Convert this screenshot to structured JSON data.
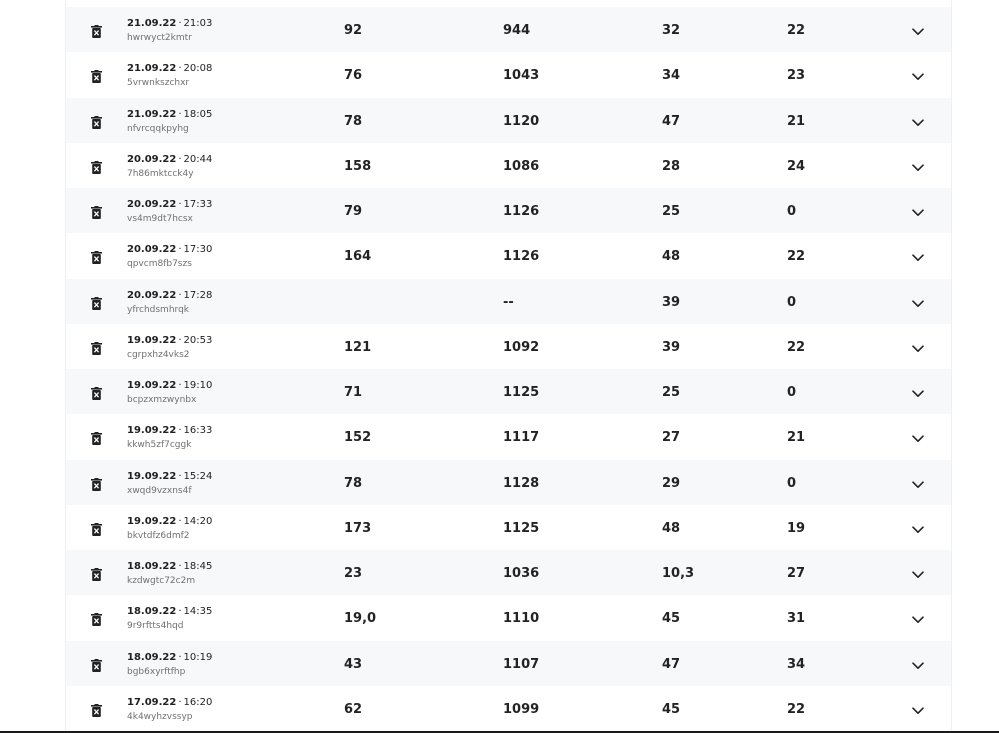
{
  "icons": {
    "delete": "trash-icon",
    "expand": "chevron-down-icon"
  },
  "colors": {
    "row_alt": "#f7f8fa",
    "text_primary": "#232323",
    "text_secondary": "#707070"
  },
  "rows": [
    {
      "date": "21.09.22",
      "time": "21:03",
      "code": "hwrwyct2kmtr",
      "v1": "92",
      "v2": "944",
      "v3": "32",
      "v4": "22"
    },
    {
      "date": "21.09.22",
      "time": "20:08",
      "code": "5vrwnkszchxr",
      "v1": "76",
      "v2": "1043",
      "v3": "34",
      "v4": "23"
    },
    {
      "date": "21.09.22",
      "time": "18:05",
      "code": "nfvrcqqkpyhg",
      "v1": "78",
      "v2": "1120",
      "v3": "47",
      "v4": "21"
    },
    {
      "date": "20.09.22",
      "time": "20:44",
      "code": "7h86mktcck4y",
      "v1": "158",
      "v2": "1086",
      "v3": "28",
      "v4": "24"
    },
    {
      "date": "20.09.22",
      "time": "17:33",
      "code": "vs4m9dt7hcsx",
      "v1": "79",
      "v2": "1126",
      "v3": "25",
      "v4": "0"
    },
    {
      "date": "20.09.22",
      "time": "17:30",
      "code": "qpvcm8fb7szs",
      "v1": "164",
      "v2": "1126",
      "v3": "48",
      "v4": "22"
    },
    {
      "date": "20.09.22",
      "time": "17:28",
      "code": "yfrchdsmhrqk",
      "v1": "",
      "v2": "--",
      "v3": "39",
      "v4": "0"
    },
    {
      "date": "19.09.22",
      "time": "20:53",
      "code": "cgrpxhz4vks2",
      "v1": "121",
      "v2": "1092",
      "v3": "39",
      "v4": "22"
    },
    {
      "date": "19.09.22",
      "time": "19:10",
      "code": "bcpzxmzwynbx",
      "v1": "71",
      "v2": "1125",
      "v3": "25",
      "v4": "0"
    },
    {
      "date": "19.09.22",
      "time": "16:33",
      "code": "kkwh5zf7cggk",
      "v1": "152",
      "v2": "1117",
      "v3": "27",
      "v4": "21"
    },
    {
      "date": "19.09.22",
      "time": "15:24",
      "code": "xwqd9vzxns4f",
      "v1": "78",
      "v2": "1128",
      "v3": "29",
      "v4": "0"
    },
    {
      "date": "19.09.22",
      "time": "14:20",
      "code": "bkvtdfz6dmf2",
      "v1": "173",
      "v2": "1125",
      "v3": "48",
      "v4": "19"
    },
    {
      "date": "18.09.22",
      "time": "18:45",
      "code": "kzdwgtc72c2m",
      "v1": "23",
      "v2": "1036",
      "v3": "10,3",
      "v4": "27"
    },
    {
      "date": "18.09.22",
      "time": "14:35",
      "code": "9r9rftts4hqd",
      "v1": "19,0",
      "v2": "1110",
      "v3": "45",
      "v4": "31"
    },
    {
      "date": "18.09.22",
      "time": "10:19",
      "code": "bgb6xyrftfhp",
      "v1": "43",
      "v2": "1107",
      "v3": "47",
      "v4": "34"
    },
    {
      "date": "17.09.22",
      "time": "16:20",
      "code": "4k4wyhzvssyp",
      "v1": "62",
      "v2": "1099",
      "v3": "45",
      "v4": "22"
    }
  ]
}
